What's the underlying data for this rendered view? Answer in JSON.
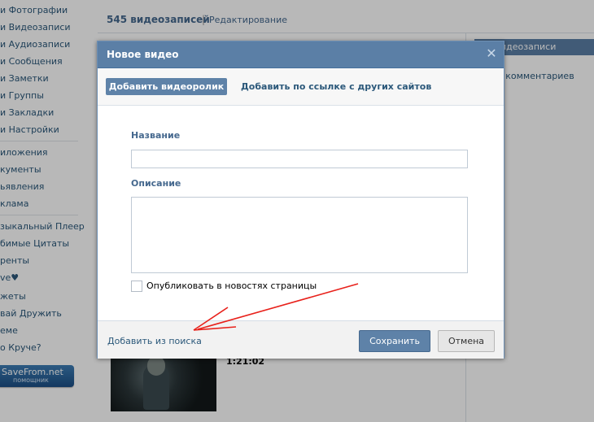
{
  "sidebar": {
    "items": [
      {
        "label": "и Фотографии"
      },
      {
        "label": "и Видеозаписи"
      },
      {
        "label": "и Аудиозаписи"
      },
      {
        "label": "и Сообщения"
      },
      {
        "label": "и Заметки"
      },
      {
        "label": "и Группы"
      },
      {
        "label": "и Закладки"
      },
      {
        "label": "и Настройки"
      },
      {
        "label": "иложения"
      },
      {
        "label": "кументы"
      },
      {
        "label": "ьявления"
      },
      {
        "label": "клама"
      },
      {
        "label": "зыкальный Плеер"
      },
      {
        "label": "бимые Цитаты"
      },
      {
        "label": "ренты"
      },
      {
        "label": "ve♥"
      },
      {
        "label": "жеты"
      },
      {
        "label": "вай Дружить"
      },
      {
        "label": "еме"
      },
      {
        "label": "о Круче?"
      }
    ],
    "savefrom": {
      "title": "SaveFrom.net",
      "subtitle": "помощник"
    }
  },
  "page": {
    "video_count": "545 видеозаписей",
    "separator": "|",
    "edit_link": "Редактирование",
    "right_tab": "идеозаписи",
    "right_comments": "о комментариев",
    "video_time": "1:21:02"
  },
  "modal": {
    "title": "Новое видео",
    "close_symbol": "✕",
    "tabs": {
      "upload": "Добавить видеоролик",
      "link": "Добавить по ссылке с других сайтов"
    },
    "name_label": "Название",
    "name_value": "",
    "description_label": "Описание",
    "description_value": "",
    "publish_label": "Опубликовать в новостях страницы",
    "publish_checked": false,
    "footer": {
      "add_from_search": "Добавить из поиска",
      "save": "Сохранить",
      "cancel": "Отмена"
    }
  },
  "annotation": {
    "arrow_color": "#e8211b"
  },
  "colors": {
    "header_blue": "#5b7fa6",
    "link_blue": "#2b587a",
    "label_blue": "#45688e"
  }
}
